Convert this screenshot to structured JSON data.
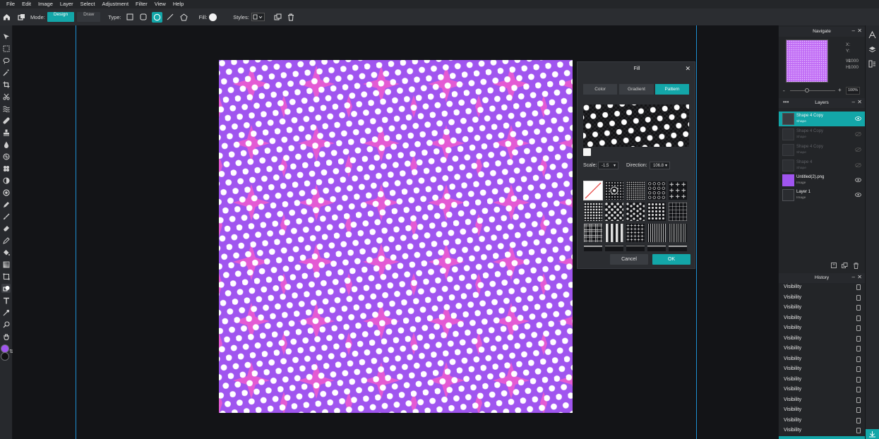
{
  "menu": [
    "File",
    "Edit",
    "Image",
    "Layer",
    "Select",
    "Adjustment",
    "Filter",
    "View",
    "Help"
  ],
  "toolbar": {
    "mode_label": "Mode:",
    "design_label": "Design",
    "draw_label": "Draw",
    "type_label": "Type:",
    "fill_label": "Fill:",
    "styles_label": "Styles:"
  },
  "colors": {
    "accent": "#13a6a8",
    "canvas_bg": "#a055ef",
    "canvas_star": "#ec5bd2",
    "dots": "#ffffff",
    "foreground": "#a055ef",
    "background": "#111111",
    "guide": "#1d8fd2"
  },
  "fill_dialog": {
    "title": "Fill",
    "tabs": [
      "Color",
      "Gradient",
      "Pattern"
    ],
    "active_tab": "Pattern",
    "scale_label": "Scale:",
    "scale_value": "-1.5",
    "direction_label": "Direction:",
    "direction_value": "106.8",
    "cancel_label": "Cancel",
    "ok_label": "OK"
  },
  "navigate": {
    "title": "Navigate",
    "x_label": "X:",
    "y_label": "Y:",
    "w_label": "W:",
    "h_label": "H:",
    "w_value": "1000",
    "h_value": "1000",
    "zoom": "100%"
  },
  "layers": {
    "title": "Layers",
    "items": [
      {
        "name": "Shape 4 Copy",
        "type": "Shape",
        "selected": true,
        "visible": true
      },
      {
        "name": "Shape 4 Copy",
        "type": "Shape",
        "selected": false,
        "visible": false
      },
      {
        "name": "Shape 4 Copy",
        "type": "Shape",
        "selected": false,
        "visible": false
      },
      {
        "name": "Shape 4",
        "type": "Shape",
        "selected": false,
        "visible": false
      },
      {
        "name": "Untitled(2).png",
        "type": "Image",
        "selected": false,
        "visible": true
      },
      {
        "name": "Layer 1",
        "type": "Image",
        "selected": false,
        "visible": true
      }
    ]
  },
  "history": {
    "title": "History",
    "items": [
      "Visibility",
      "Visibility",
      "Visibility",
      "Visibility",
      "Visibility",
      "Visibility",
      "Visibility",
      "Visibility",
      "Visibility",
      "Visibility",
      "Visibility",
      "Visibility",
      "Visibility",
      "Visibility",
      "Visibility"
    ]
  }
}
